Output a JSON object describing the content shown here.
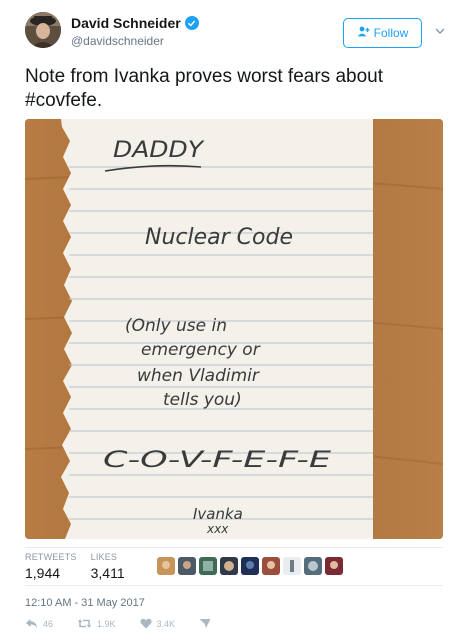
{
  "author": {
    "name": "David Schneider",
    "handle": "@davidschneider",
    "verified": true,
    "follow_label": "Follow"
  },
  "tweet": {
    "text": "Note from Ivanka proves worst fears about #covfefe.",
    "timestamp": "12:10 AM - 31 May 2017"
  },
  "note": {
    "line1": "DADDY",
    "line2": "Nuclear Code",
    "line3": "(Only use in",
    "line4": "emergency or",
    "line5": "when Vladimir",
    "line6": "tells you)",
    "line7": "C-O-V-F-E-F-E",
    "signature": "Ivanka",
    "kisses": "xxx"
  },
  "stats": {
    "retweets_label": "RETWEETS",
    "retweets_value": "1,944",
    "likes_label": "LIKES",
    "likes_value": "3,411"
  },
  "actions": {
    "reply_count": "46",
    "retweet_count": "1.9K",
    "like_count": "3.4K"
  },
  "icons": {
    "verified": "verified-badge-icon",
    "follow": "add-user-icon",
    "more": "chevron-down-icon",
    "reply": "reply-icon",
    "retweet": "retweet-icon",
    "like": "heart-icon",
    "dm": "direct-message-icon"
  },
  "colors": {
    "accent": "#1da1f2",
    "muted": "#657786",
    "icon_gray": "#aab8c2"
  }
}
